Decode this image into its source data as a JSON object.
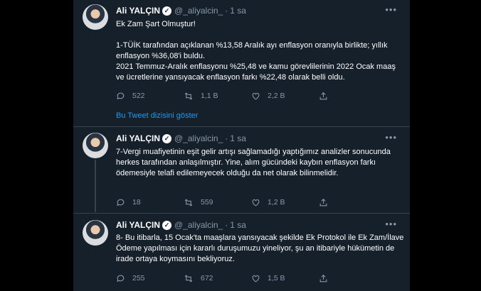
{
  "tweets": [
    {
      "name": "Ali YALÇIN",
      "handle": "@_aliyalcin_",
      "dot": "·",
      "time": "1 sa",
      "text": "Ek Zam Şart Olmuştur!\n\n1-TÜİK tarafından açıklanan %13,58 Aralık ayı enflasyon oranıyla birlikte; yıllık enflasyon %36,08'i buldu.\n2021 Temmuz-Aralık enflasyonu %25,48 ve kamu görevlilerinin 2022 Ocak maaş ve ücretlerine yansıyacak enflasyon farkı %22,48 olarak belli oldu.",
      "replies": "522",
      "retweets": "1,1 B",
      "likes": "2,2 B"
    },
    {
      "name": "Ali YALÇIN",
      "handle": "@_aliyalcin_",
      "dot": "·",
      "time": "1 sa",
      "text": "7-Vergi muafiyetinin eşit gelir artışı sağlamadığı yaptığımız analizler sonucunda herkes tarafından anlaşılmıştır. Yine, alım gücündeki kaybın enflasyon farkı ödemesiyle telafi edilemeyecek olduğu da net olarak bilinmelidir.",
      "replies": "18",
      "retweets": "559",
      "likes": "1,2 B"
    },
    {
      "name": "Ali YALÇIN",
      "handle": "@_aliyalcin_",
      "dot": "·",
      "time": "1 sa",
      "text": "8- Bu itibarla, 15 Ocak'ta maaşlara yansıyacak şekilde Ek Protokol ile Ek Zam/İlave Ödeme yapılması için kararlı duruşumuzu yineliyor, şu an itibariyle hükümetin de irade ortaya koymasını bekliyoruz.",
      "replies": "255",
      "retweets": "672",
      "likes": "1,5 B"
    }
  ],
  "show_thread": "Bu Tweet dizisini göster",
  "colors": {
    "background": "#15202b",
    "text": "#ffffff",
    "muted": "#8899a6",
    "link": "#1d9bf0",
    "border": "#38444d"
  },
  "icons": [
    "verified-icon",
    "more-icon",
    "reply-icon",
    "retweet-icon",
    "like-icon",
    "share-icon"
  ]
}
